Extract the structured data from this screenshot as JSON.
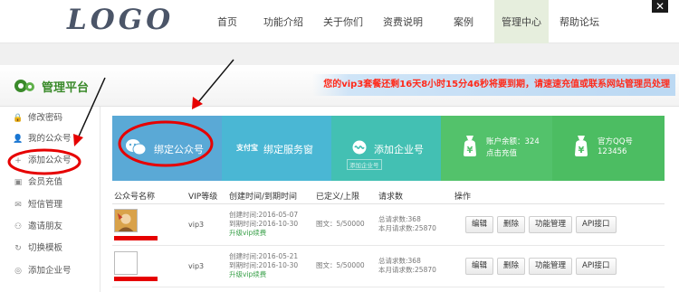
{
  "header": {
    "logo": "LOGO",
    "nav": [
      {
        "label": "首页"
      },
      {
        "label": "功能介绍"
      },
      {
        "label": "关于你们"
      },
      {
        "label": "资费说明"
      },
      {
        "label": "案例"
      },
      {
        "label": "管理中心"
      },
      {
        "label": "帮助论坛"
      }
    ],
    "close_glyph": "✕"
  },
  "platform": {
    "title": "管理平台",
    "notice": "您的vip3套餐还剩16天8小时15分46秒将要到期，请速速充值或联系网站管理员处理"
  },
  "sidebar": {
    "items": [
      {
        "label": "修改密码",
        "icon": "lock-icon",
        "glyph": "🔒"
      },
      {
        "label": "我的公众号",
        "icon": "user-icon",
        "glyph": "👤"
      },
      {
        "label": "添加公众号",
        "icon": "plus-icon",
        "glyph": "+"
      },
      {
        "label": "会员充值",
        "icon": "wallet-icon",
        "glyph": "▣"
      },
      {
        "label": "短信管理",
        "icon": "message-icon",
        "glyph": "✉"
      },
      {
        "label": "邀请朋友",
        "icon": "friends-icon",
        "glyph": "⚇"
      },
      {
        "label": "切换模板",
        "icon": "refresh-icon",
        "glyph": "↻"
      },
      {
        "label": "添加企业号",
        "icon": "enterprise-icon",
        "glyph": "◎"
      }
    ]
  },
  "tiles": [
    {
      "label": "绑定公众号",
      "icon": "wechat-icon",
      "color": "#5aa9d6"
    },
    {
      "label": "绑定服务窗",
      "logo_text": "支付宝",
      "icon": "alipay-icon",
      "color": "#4ab7d4"
    },
    {
      "label": "添加企业号",
      "sub": "添加企业号",
      "icon": "enterprise-link-icon",
      "color": "#43c0b3"
    },
    {
      "label": "账户余额：324",
      "sub": "点击充值",
      "icon": "yen-bag-icon",
      "color": "#53c26b"
    },
    {
      "label": "官方QQ号",
      "sub": "123456",
      "icon": "yen-bag-icon",
      "color": "#4cbd62"
    }
  ],
  "table": {
    "headers": [
      "公众号名称",
      "VIP等级",
      "创建时间/到期时间",
      "已定义/上限",
      "请求数",
      "操作"
    ],
    "rows": [
      {
        "vip": "vip3",
        "created": "创建时间:2016-05-07",
        "expires": "到期时间:2016-10-30",
        "upgrade": "升级vip续费",
        "quota": "图文：5/50000",
        "req_total": "总请求数:368",
        "req_month": "本月请求数:25870",
        "actions": [
          "编辑",
          "删除",
          "功能管理",
          "API接口"
        ]
      },
      {
        "vip": "vip3",
        "created": "创建时间:2016-05-21",
        "expires": "到期时间:2016-10-30",
        "upgrade": "升级vip续费",
        "quota": "图文：5/50000",
        "req_total": "总请求数:368",
        "req_month": "本月请求数:25870",
        "actions": [
          "编辑",
          "删除",
          "功能管理",
          "API接口"
        ]
      }
    ]
  },
  "colors": {
    "accent_green": "#3a8a2a",
    "notice_red": "#ff2a1a",
    "annotation_red": "#e60000",
    "nav_active": "#e6eedd"
  }
}
